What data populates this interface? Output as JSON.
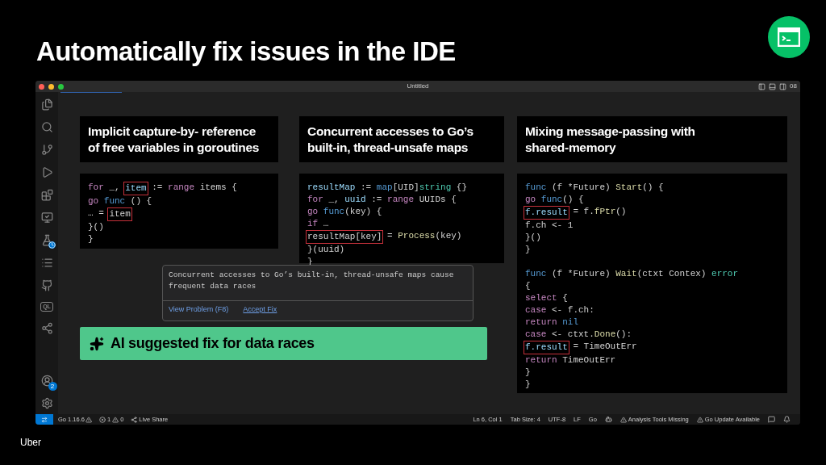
{
  "slide_title": "Automatically fix issues in the IDE",
  "window": {
    "title": "Untitled",
    "layout_label": "08"
  },
  "activity_bar": {
    "ql_label": "QL",
    "accounts_badge": "2"
  },
  "cards": [
    {
      "title": "Implicit capture-by- reference of free variables in goroutines",
      "code": [
        [
          [
            {
              "t": "for",
              "kind": "kw"
            },
            {
              "t": " _, ",
              "kind": "txt"
            },
            {
              "t": "item",
              "kind": "mark-var"
            },
            {
              "t": " := ",
              "kind": "txt"
            },
            {
              "t": "range",
              "kind": "kw"
            },
            {
              "t": " items {",
              "kind": "txt"
            }
          ],
          [
            {
              "t": "go",
              "kind": "kw"
            },
            {
              "t": " func",
              "kind": "fn"
            },
            {
              "t": " () {",
              "kind": "txt"
            }
          ],
          [
            {
              "t": "… = ",
              "kind": "txt"
            },
            {
              "t": "item",
              "kind": "mark-txt"
            }
          ],
          [
            {
              "t": "}()",
              "kind": "txt"
            }
          ],
          [
            {
              "t": "}",
              "kind": "txt"
            }
          ]
        ]
      ]
    },
    {
      "title": "Concurrent accesses to Go’s built-in, thread-unsafe maps",
      "code": [
        [
          [
            {
              "t": "resultMap",
              "kind": "var"
            },
            {
              "t": " := ",
              "kind": "txt"
            },
            {
              "t": "map",
              "kind": "fn"
            },
            {
              "t": "[UID]",
              "kind": "txt"
            },
            {
              "t": "string",
              "kind": "type"
            },
            {
              "t": " {}",
              "kind": "txt"
            }
          ],
          [
            {
              "t": "for",
              "kind": "kw"
            },
            {
              "t": " _, ",
              "kind": "txt"
            },
            {
              "t": "uuid",
              "kind": "var"
            },
            {
              "t": " := ",
              "kind": "txt"
            },
            {
              "t": "range",
              "kind": "kw"
            },
            {
              "t": " UUIDs {",
              "kind": "txt"
            }
          ],
          [
            {
              "t": "go",
              "kind": "kw"
            },
            {
              "t": " func",
              "kind": "fn"
            },
            {
              "t": "(key) {",
              "kind": "txt"
            }
          ],
          [
            {
              "t": "if",
              "kind": "kw"
            },
            {
              "t": " …",
              "kind": "txt"
            }
          ],
          [
            {
              "t": "resultMap[key]",
              "kind": "mark-txt"
            },
            {
              "t": " = ",
              "kind": "txt"
            },
            {
              "t": "Process",
              "kind": "call"
            },
            {
              "t": "(key)",
              "kind": "txt"
            }
          ],
          [
            {
              "t": "}(uuid)",
              "kind": "txt"
            }
          ],
          [
            {
              "t": "}",
              "kind": "txt"
            }
          ]
        ]
      ]
    },
    {
      "title": "Mixing message-passing with shared-memory",
      "code": [
        [
          [
            {
              "t": "func",
              "kind": "fn"
            },
            {
              "t": " (f *Future) ",
              "kind": "txt"
            },
            {
              "t": "Start",
              "kind": "call"
            },
            {
              "t": "() {",
              "kind": "txt"
            }
          ],
          [
            {
              "t": "go",
              "kind": "kw"
            },
            {
              "t": " func",
              "kind": "fn"
            },
            {
              "t": "() {",
              "kind": "txt"
            }
          ],
          [
            {
              "t": "f.result",
              "kind": "mark-var"
            },
            {
              "t": " = f.",
              "kind": "txt"
            },
            {
              "t": "fPtr",
              "kind": "call"
            },
            {
              "t": "()",
              "kind": "txt"
            }
          ],
          [
            {
              "t": "f.ch <- 1",
              "kind": "txt"
            }
          ],
          [
            {
              "t": "}()",
              "kind": "txt"
            }
          ],
          [
            {
              "t": "}",
              "kind": "txt"
            }
          ]
        ],
        [
          [
            {
              "t": "func",
              "kind": "fn"
            },
            {
              "t": " (f *Future) ",
              "kind": "txt"
            },
            {
              "t": "Wait",
              "kind": "call"
            },
            {
              "t": "(ctxt Contex) ",
              "kind": "txt"
            },
            {
              "t": "error",
              "kind": "type"
            }
          ],
          [
            {
              "t": "{",
              "kind": "txt"
            }
          ],
          [
            {
              "t": "select",
              "kind": "kw"
            },
            {
              "t": " {",
              "kind": "txt"
            }
          ],
          [
            {
              "t": "case",
              "kind": "kw"
            },
            {
              "t": " <- f.ch:",
              "kind": "txt"
            }
          ],
          [
            {
              "t": "return",
              "kind": "kw"
            },
            {
              "t": " nil",
              "kind": "fn"
            }
          ],
          [
            {
              "t": "case",
              "kind": "kw"
            },
            {
              "t": " <- ctxt.",
              "kind": "txt"
            },
            {
              "t": "Done",
              "kind": "call"
            },
            {
              "t": "():",
              "kind": "txt"
            }
          ],
          [
            {
              "t": "f.result",
              "kind": "mark-var"
            },
            {
              "t": " = TimeOutErr",
              "kind": "txt"
            }
          ],
          [
            {
              "t": "return",
              "kind": "kw"
            },
            {
              "t": " TimeOutErr",
              "kind": "txt"
            }
          ],
          [
            {
              "t": "}",
              "kind": "txt"
            }
          ],
          [
            {
              "t": "}",
              "kind": "txt"
            }
          ]
        ]
      ]
    }
  ],
  "hover": {
    "message": "Concurrent accesses to Go’s built-in, thread-unsafe maps cause frequent data races",
    "actions": [
      {
        "label": "View Problem (F8)",
        "kind": "plain"
      },
      {
        "label": "Accept Fix",
        "kind": "underlined"
      }
    ]
  },
  "banner": {
    "text": "AI suggested fix for data races"
  },
  "status_bar": {
    "left": [
      {
        "kind": "version",
        "text": "Go 1.16.6"
      },
      {
        "kind": "problems",
        "errors": "1",
        "warnings": "0"
      },
      {
        "kind": "share",
        "text": "Live Share"
      }
    ],
    "right": [
      {
        "kind": "text",
        "text": "Ln 6, Col 1"
      },
      {
        "kind": "text",
        "text": "Tab Size: 4"
      },
      {
        "kind": "text",
        "text": "UTF-8"
      },
      {
        "kind": "text",
        "text": "LF"
      },
      {
        "kind": "text",
        "text": "Go"
      },
      {
        "kind": "copilot"
      },
      {
        "kind": "warning",
        "text": "Analysis Tools Missing"
      },
      {
        "kind": "warning",
        "text": "Go Update Available"
      },
      {
        "kind": "feedback"
      },
      {
        "kind": "bell"
      }
    ]
  },
  "footer": {
    "brand": "Uber"
  }
}
